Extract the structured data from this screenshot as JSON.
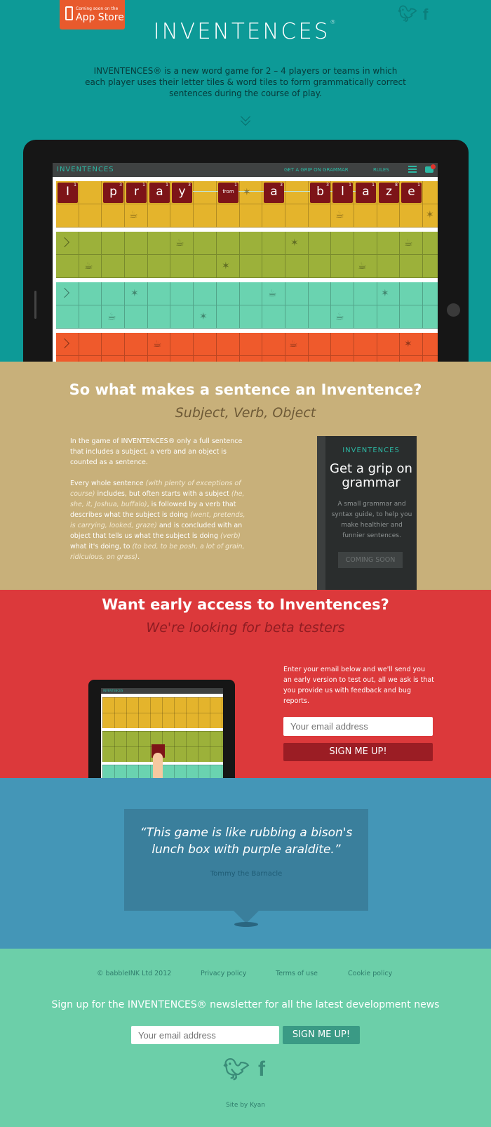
{
  "header": {
    "appstore_small": "Coming soon on the",
    "appstore_big": "App Store",
    "logo": "INVENTENCES",
    "description": "INVENTENCES® is a new word game for 2 – 4 players or teams in which each player uses their letter tiles & word tiles to form grammatically correct sentences during the course of play."
  },
  "app": {
    "logo": "INVENTENCES",
    "nav": [
      "GET A GRIP ON GRAMMAR",
      "RULES"
    ],
    "tiles": [
      {
        "letter": "I",
        "score": "1"
      },
      {
        "letter": "p",
        "score": "3"
      },
      {
        "letter": "r",
        "score": "1"
      },
      {
        "letter": "a",
        "score": "1"
      },
      {
        "letter": "y",
        "score": "3"
      },
      {
        "letter": "from",
        "score": "1"
      },
      {
        "letter": "a",
        "score": "3"
      },
      {
        "letter": "b",
        "score": "3"
      },
      {
        "letter": "l",
        "score": "1"
      },
      {
        "letter": "a",
        "score": "1"
      },
      {
        "letter": "z",
        "score": "8"
      },
      {
        "letter": "e",
        "score": "1"
      }
    ]
  },
  "grammar": {
    "heading": "So what makes a sentence an Inventence?",
    "subheading": "Subject, Verb, Object",
    "para1": "In the game of INVENTENCES® only a full sentence that includes a subject, a verb and an object is counted as a sentence.",
    "para2_a": "Every whole sentence ",
    "para2_b": "(with plenty of exceptions of course)",
    "para2_c": " includes, but often starts with a subject ",
    "para2_d": "(he, she, it, Joshua, buffalo)",
    "para2_e": ", is followed by a verb that describes what the subject is doing ",
    "para2_f": "(went, pretends, is carrying, looked, graze)",
    "para2_g": " and is concluded with an object that tells us what the subject is doing ",
    "para2_h": "(verb)",
    "para2_i": " what it's doing, to ",
    "para2_j": "(to bed, to be posh, a lot of grain, ridiculous, on grass)",
    "para2_k": ".",
    "book": {
      "logo": "INVENTENCES",
      "title": "Get a grip on grammar",
      "desc": "A small grammar and syntax guide, to help you make healthier and funnier sentences.",
      "button": "COMING SOON"
    }
  },
  "beta": {
    "heading": "Want early access to Inventences?",
    "subheading": "We're looking for beta testers",
    "text": "Enter your email below and we'll send you an early version to test out, all we ask is that you provide us with feedback and bug reports.",
    "placeholder": "Your email address",
    "button": "SIGN ME UP!",
    "mini_logo": "INVENTENCES"
  },
  "quote": {
    "text": "“This game is like rubbing a bison's lunch box with purple araldite.”",
    "author": "Tommy the Barnacle"
  },
  "footer": {
    "copyright": "© babbleINK Ltd 2012",
    "links": [
      "Privacy policy",
      "Terms of use",
      "Cookie policy"
    ],
    "newsletter": "Sign up for the INVENTENCES® newsletter for all the latest development news",
    "placeholder": "Your email address",
    "button": "SIGN ME UP!",
    "credit": "Site by Kyan"
  },
  "colors": {
    "hero": "#0d9a97",
    "grammar": "#c8b07a",
    "beta": "#dc393b",
    "quote": "#4496b7",
    "footer": "#6ccfa9"
  }
}
